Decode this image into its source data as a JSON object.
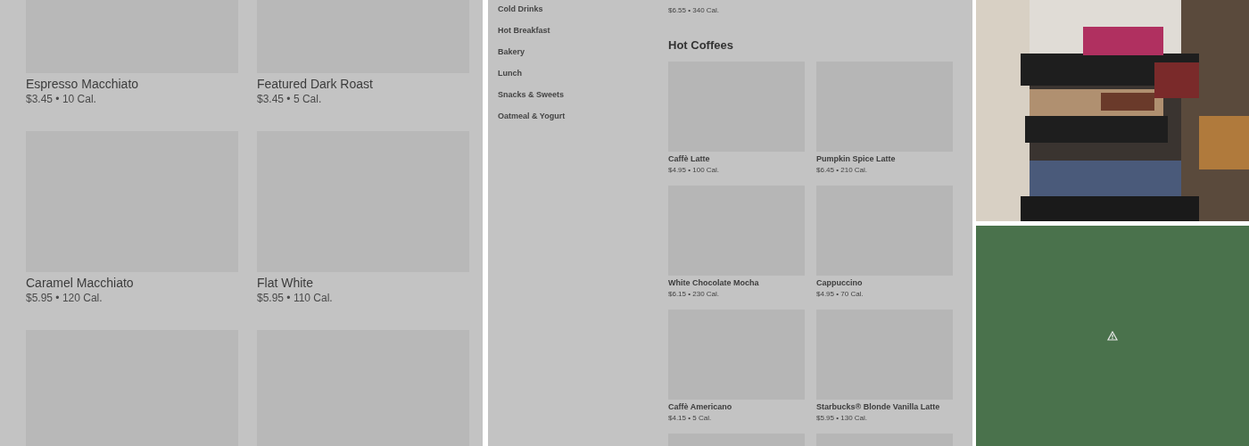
{
  "left_panel": {
    "items": [
      {
        "name": "Espresso Macchiato",
        "price_line": "$3.45 • 10 Cal."
      },
      {
        "name": "Featured Dark Roast",
        "price_line": "$3.45 • 5 Cal."
      },
      {
        "name": "Caramel Macchiato",
        "price_line": "$5.95 • 120 Cal."
      },
      {
        "name": "Flat White",
        "price_line": "$5.95 • 110 Cal."
      }
    ]
  },
  "middle_panel": {
    "categories": [
      {
        "label": "Cold Drinks"
      },
      {
        "label": "Hot Breakfast"
      },
      {
        "label": "Bakery"
      },
      {
        "label": "Lunch"
      },
      {
        "label": "Snacks & Sweets"
      },
      {
        "label": "Oatmeal & Yogurt"
      }
    ],
    "previous_row": [
      {
        "price_line": "$6.55 • 340 Cal."
      }
    ],
    "section_title": "Hot Coffees",
    "items": [
      {
        "name": "Caffè Latte",
        "price_line": "$4.95 • 100 Cal."
      },
      {
        "name": "Pumpkin Spice Latte",
        "price_line": "$6.45 • 210 Cal."
      },
      {
        "name": "White Chocolate Mocha",
        "price_line": "$6.15 • 230 Cal."
      },
      {
        "name": "Cappuccino",
        "price_line": "$4.95 • 70 Cal."
      },
      {
        "name": "Caffè Americano",
        "price_line": "$4.15 • 5 Cal."
      },
      {
        "name": "Starbucks® Blonde Vanilla Latte",
        "price_line": "$5.95 • 130 Cal."
      }
    ]
  },
  "right_panel": {
    "placeholder": {
      "kind": "warning"
    }
  }
}
